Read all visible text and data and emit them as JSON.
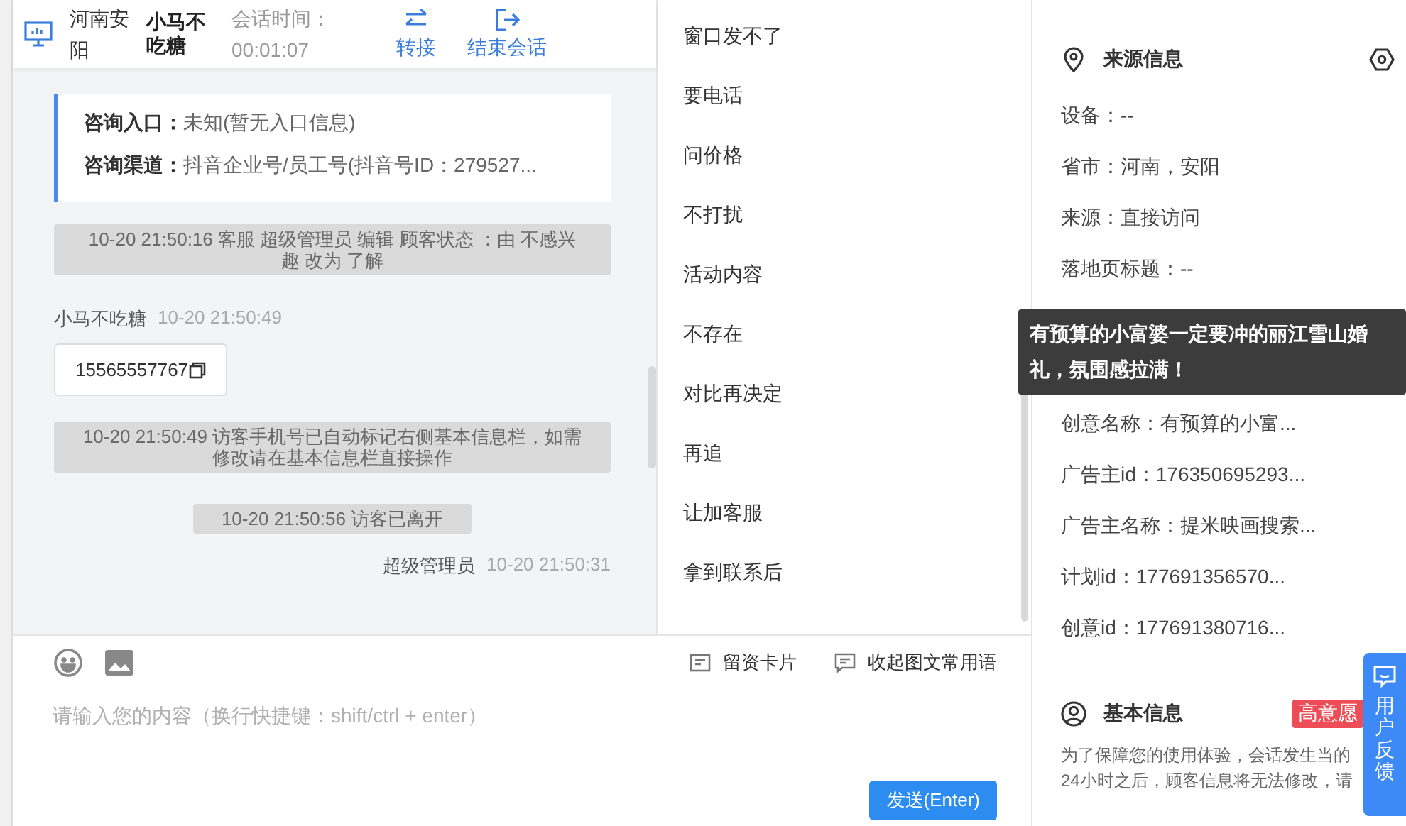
{
  "header": {
    "location": "河南安阳",
    "customer": "小马不吃糖",
    "session_label": "会话时间：",
    "session_time": "00:01:07",
    "actions": [
      {
        "kind": "transfer",
        "label": "转接"
      },
      {
        "kind": "end",
        "label": "结束会话"
      }
    ]
  },
  "consult_card": {
    "rows": [
      {
        "label": "咨询入口：",
        "value": "未知(暂无入口信息)"
      },
      {
        "label": "咨询渠道：",
        "value": "抖音企业号/员工号(抖音号ID：279527..."
      }
    ]
  },
  "messages": [
    {
      "kind": "system",
      "text": "10-20 21:50:16 客服 超级管理员 编辑 顾客状态 ：由 不感兴趣 改为 了解"
    },
    {
      "kind": "customer",
      "sender": "小马不吃糖",
      "time": "10-20 21:50:49",
      "text": "15565557767"
    },
    {
      "kind": "system",
      "text": "10-20 21:50:49 访客手机号已自动标记右侧基本信息栏，如需修改请在基本信息栏直接操作"
    },
    {
      "kind": "system",
      "text": "10-20 21:50:56 访客已离开"
    },
    {
      "kind": "agent",
      "sender": "超级管理员",
      "time": "10-20 21:50:31"
    }
  ],
  "quick_replies": [
    "窗口发不了",
    "要电话",
    "问价格",
    "不打扰",
    "活动内容",
    "不存在",
    "对比再决定",
    "再追",
    "让加客服",
    "拿到联系后"
  ],
  "composer": {
    "tools": [
      {
        "kind": "card",
        "label": "留资卡片"
      },
      {
        "kind": "phrases",
        "label": "收起图文常用语"
      }
    ],
    "placeholder": "请输入您的内容（换行快捷键：shift/ctrl + enter）",
    "send_button": "发送(Enter)"
  },
  "source_info": {
    "title": "来源信息",
    "rows_top": [
      "设备：--",
      "省市：河南，安阳",
      "来源：直接访问",
      "落地页标题：--"
    ],
    "tooltip": "有预算的小富婆一定要冲的丽江雪山婚礼，氛围感拉满！",
    "rows_bottom": [
      "创意名称：有预算的小富...",
      "广告主id：176350695293...",
      "广告主名称：提米映画搜索...",
      "计划id：177691356570...",
      "创意id：177691380716..."
    ]
  },
  "basic_info": {
    "title": "基本信息",
    "badge": "高意愿",
    "notice": "为了保障您的使用体验，会话发生当的24小时之后，顾客信息将无法修改，请"
  },
  "feedback_button": "用户反馈"
}
